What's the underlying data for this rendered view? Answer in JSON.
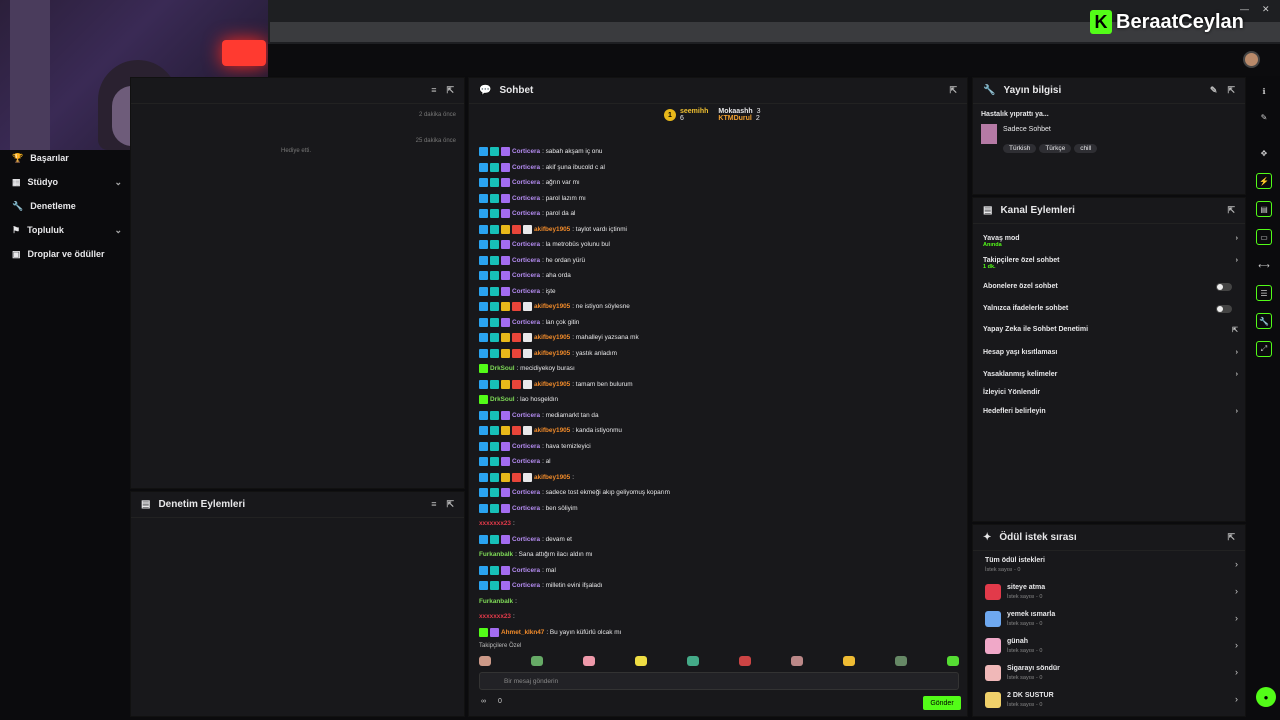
{
  "brand": {
    "name": "BeraatCeylan"
  },
  "sidebar": {
    "items": [
      {
        "label": "Başarılar"
      },
      {
        "label": "Stüdyo"
      },
      {
        "label": "Denetleme"
      },
      {
        "label": "Topluluk"
      },
      {
        "label": "Droplar ve ödüller"
      }
    ]
  },
  "left_panel": {
    "times": [
      "2 dakika önce",
      "25 dakika önce"
    ],
    "gift_text": "Hediye etti."
  },
  "moderation": {
    "title": "Denetim Eylemleri"
  },
  "chat": {
    "title": "Sohbet",
    "leaders": [
      {
        "rank": "1",
        "name": "seemihh",
        "count": "6"
      },
      {
        "name": "Mokaashh",
        "count": "3"
      },
      {
        "name": "KTMDurul",
        "count": "2"
      }
    ],
    "messages": [
      {
        "badges": [
          "b1",
          "b2",
          "b3"
        ],
        "user": "Corticera",
        "color": "#b58cf2",
        "text": ": sabah akşam iç onu"
      },
      {
        "badges": [
          "b1",
          "b2",
          "b3"
        ],
        "user": "Corticera",
        "color": "#b58cf2",
        "text": ": akif şuna ibucold c al"
      },
      {
        "badges": [
          "b1",
          "b2",
          "b3"
        ],
        "user": "Corticera",
        "color": "#b58cf2",
        "text": ": ağrın var mı"
      },
      {
        "badges": [
          "b1",
          "b2",
          "b3"
        ],
        "user": "Corticera",
        "color": "#b58cf2",
        "text": ": parol lazım mı"
      },
      {
        "badges": [
          "b1",
          "b2",
          "b3"
        ],
        "user": "Corticera",
        "color": "#b58cf2",
        "text": ": parol da al"
      },
      {
        "badges": [
          "b1",
          "b2",
          "b4",
          "b5",
          "b6"
        ],
        "user": "akifbey1905",
        "color": "#f08a2a",
        "text": ": taylot vardı içtinmi"
      },
      {
        "badges": [
          "b1",
          "b2",
          "b3"
        ],
        "user": "Corticera",
        "color": "#b58cf2",
        "text": ": la metrobüs yolunu bul"
      },
      {
        "badges": [
          "b1",
          "b2",
          "b3"
        ],
        "user": "Corticera",
        "color": "#b58cf2",
        "text": ": he ordan yürü"
      },
      {
        "badges": [
          "b1",
          "b2",
          "b3"
        ],
        "user": "Corticera",
        "color": "#b58cf2",
        "text": ": aha orda"
      },
      {
        "badges": [
          "b1",
          "b2",
          "b3"
        ],
        "user": "Corticera",
        "color": "#b58cf2",
        "text": ": işte"
      },
      {
        "badges": [
          "b1",
          "b2",
          "b4",
          "b5",
          "b6"
        ],
        "user": "akifbey1905",
        "color": "#f08a2a",
        "text": ": ne istiyon söylesne"
      },
      {
        "badges": [
          "b1",
          "b2",
          "b3"
        ],
        "user": "Corticera",
        "color": "#b58cf2",
        "text": ": lan çok gitin"
      },
      {
        "badges": [
          "b1",
          "b2",
          "b4",
          "b5",
          "b6"
        ],
        "user": "akifbey1905",
        "color": "#f08a2a",
        "text": ": mahalleyi yazsana mk"
      },
      {
        "badges": [
          "b1",
          "b2",
          "b4",
          "b5",
          "b6"
        ],
        "user": "akifbey1905",
        "color": "#f08a2a",
        "text": ": yastık anladım"
      },
      {
        "badges": [
          "b7"
        ],
        "user": "DrkSoul",
        "color": "#7ed957",
        "text": ": mecidiyekoy burası"
      },
      {
        "badges": [
          "b1",
          "b2",
          "b4",
          "b5",
          "b6"
        ],
        "user": "akifbey1905",
        "color": "#f08a2a",
        "text": ": tamam ben bulurum"
      },
      {
        "badges": [
          "b7"
        ],
        "user": "DrkSoul",
        "color": "#7ed957",
        "text": ": lao hosgeldın"
      },
      {
        "badges": [
          "b1",
          "b2",
          "b3"
        ],
        "user": "Corticera",
        "color": "#b58cf2",
        "text": ": mediamarkt tan da"
      },
      {
        "badges": [
          "b1",
          "b2",
          "b4",
          "b5",
          "b6"
        ],
        "user": "akifbey1905",
        "color": "#f08a2a",
        "text": ": kanda istiyonmu"
      },
      {
        "badges": [
          "b1",
          "b2",
          "b3"
        ],
        "user": "Corticera",
        "color": "#b58cf2",
        "text": ": hava temizleyici"
      },
      {
        "badges": [
          "b1",
          "b2",
          "b3"
        ],
        "user": "Corticera",
        "color": "#b58cf2",
        "text": ": al"
      },
      {
        "badges": [
          "b1",
          "b2",
          "b4",
          "b5",
          "b6"
        ],
        "user": "akifbey1905",
        "color": "#f08a2a",
        "text": ":"
      },
      {
        "badges": [
          "b1",
          "b2",
          "b3"
        ],
        "user": "Corticera",
        "color": "#b58cf2",
        "text": ": sadece tost ekmeği akıp geliyomuş koparım"
      },
      {
        "badges": [
          "b1",
          "b2",
          "b3"
        ],
        "user": "Corticera",
        "color": "#b58cf2",
        "text": ": ben söliyim"
      },
      {
        "badges": [],
        "user": "xxxxxxx23",
        "color": "#e23a4a",
        "text": ":"
      },
      {
        "badges": [
          "b1",
          "b2",
          "b3"
        ],
        "user": "Corticera",
        "color": "#b58cf2",
        "text": ": devam et"
      },
      {
        "badges": [],
        "user": "Furkanbalk",
        "color": "#7ed957",
        "text": ": Sana attığım ilacı aldın mı"
      },
      {
        "badges": [
          "b1",
          "b2",
          "b3"
        ],
        "user": "Corticera",
        "color": "#b58cf2",
        "text": ": mal"
      },
      {
        "badges": [
          "b1",
          "b2",
          "b3"
        ],
        "user": "Corticera",
        "color": "#b58cf2",
        "text": ": milletin evini ifşaladı"
      },
      {
        "badges": [],
        "user": "Furkanbalk",
        "color": "#7ed957",
        "text": ":"
      },
      {
        "badges": [],
        "user": "xxxxxxx23",
        "color": "#e23a4a",
        "text": ":"
      },
      {
        "badges": [
          "b7",
          "b3"
        ],
        "user": "Ahmet_klkn47",
        "color": "#f08a2a",
        "text": ": Bu yayın küfürlü olcak mı"
      }
    ],
    "followers_only": "Takipçilere Özel",
    "input_placeholder": "Bir mesaj gönderin",
    "send_label": "Gönder",
    "foot_count": "0",
    "foot_inf": "∞"
  },
  "stream_info": {
    "title": "Yayın bilgisi",
    "stream_title": "Hastalık yıprattı ya...",
    "category": "Sadece Sohbet",
    "tags": [
      "Türkish",
      "Türkçe",
      "chill"
    ]
  },
  "channel_actions": {
    "title": "Kanal Eylemleri",
    "rows": [
      {
        "label": "Yavaş mod",
        "sub": "Anında",
        "kind": "chev"
      },
      {
        "label": "Takipçilere özel sohbet",
        "sub": "1 dk.",
        "kind": "chev"
      },
      {
        "label": "Abonelere özel sohbet",
        "sub": "",
        "kind": "toggle"
      },
      {
        "label": "Yalnızca ifadelerle sohbet",
        "sub": "",
        "kind": "toggle"
      },
      {
        "label": "Yapay Zeka ile Sohbet Denetimi",
        "sub": "",
        "kind": "ext"
      },
      {
        "label": "Hesap yaşı kısıtlaması",
        "sub": "",
        "kind": "chev"
      },
      {
        "label": "Yasaklanmış kelimeler",
        "sub": "",
        "kind": "chev"
      },
      {
        "label": "İzleyici Yönlendir",
        "sub": "",
        "kind": "none"
      },
      {
        "label": "Hedefleri belirleyin",
        "sub": "",
        "kind": "chev"
      }
    ]
  },
  "rewards": {
    "title": "Ödül istek sırası",
    "all_label": "Tüm ödül istekleri",
    "all_count": "İstek sayısı - 0",
    "items": [
      {
        "title": "siteye atma",
        "count": "İstek sayısı - 0",
        "color": "#e23a4a"
      },
      {
        "title": "yemek ısmarla",
        "count": "İstek sayısı - 0",
        "color": "#6ea8f0"
      },
      {
        "title": "günah",
        "count": "İstek sayısı - 0",
        "color": "#f0a8c8"
      },
      {
        "title": "Sigarayı söndür",
        "count": "İstek sayısı - 0",
        "color": "#f0b8b8"
      },
      {
        "title": "2 DK SUSTUR",
        "count": "İstek sayısı - 0",
        "color": "#f0d06a"
      }
    ]
  }
}
